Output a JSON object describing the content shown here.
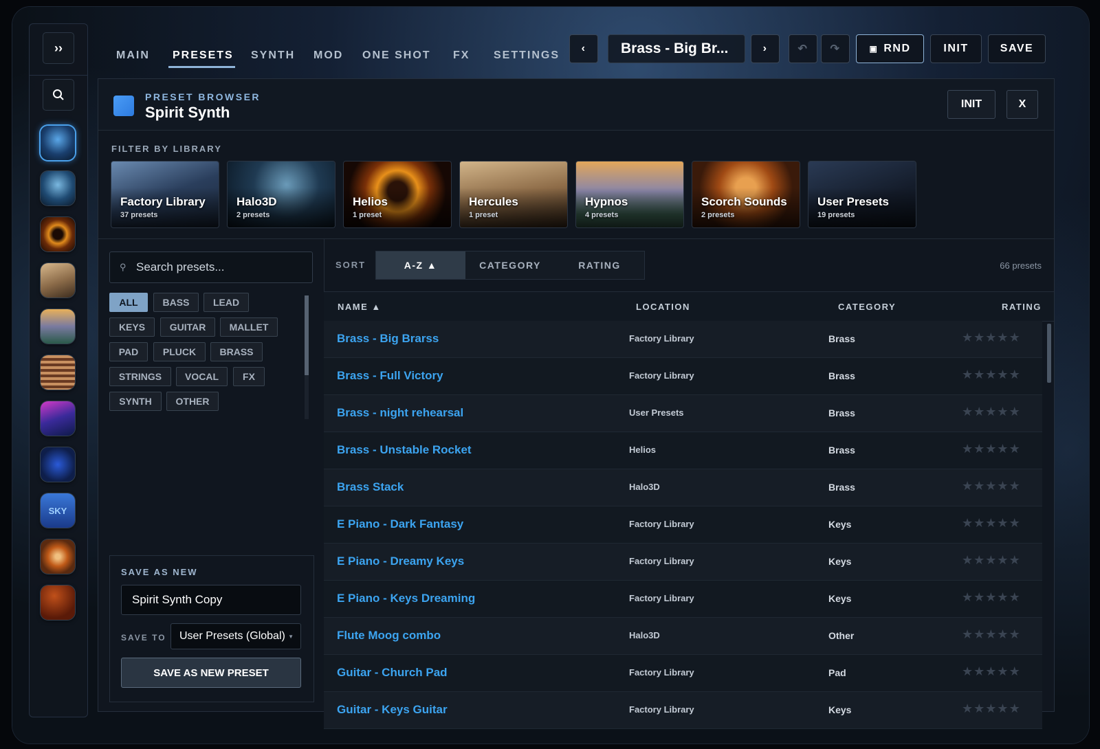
{
  "nav": {
    "tabs": [
      {
        "label": "MAIN"
      },
      {
        "label": "PRESETS"
      },
      {
        "label": "SYNTH"
      },
      {
        "label": "MOD"
      },
      {
        "label": "ONE SHOT"
      },
      {
        "label": "FX"
      },
      {
        "label": "SETTINGS"
      }
    ],
    "active_tab": "PRESETS",
    "current_preset": "Brass - Big Br...",
    "rnd_label": "RND",
    "init_label": "INIT",
    "save_label": "SAVE"
  },
  "sidebar": {
    "expand_icon": "double-chevron-right-icon",
    "search_icon": "search-icon",
    "library_thumbs": [
      "factory",
      "halo3d",
      "helios",
      "hercules",
      "hypnos",
      "scorch-strings",
      "synthwave",
      "user-presets",
      "sky-keys",
      "orbit",
      "ember"
    ]
  },
  "browser": {
    "section_label": "PRESET BROWSER",
    "title": "Spirit Synth",
    "init_label": "INIT",
    "close_label": "X",
    "filter_label": "FILTER BY LIBRARY",
    "libraries": [
      {
        "name": "Factory Library",
        "count": "37 presets"
      },
      {
        "name": "Halo3D",
        "count": "2 presets"
      },
      {
        "name": "Helios",
        "count": "1 preset"
      },
      {
        "name": "Hercules",
        "count": "1 preset"
      },
      {
        "name": "Hypnos",
        "count": "4 presets"
      },
      {
        "name": "Scorch Sounds",
        "count": "2 presets"
      },
      {
        "name": "User Presets",
        "count": "19 presets"
      }
    ]
  },
  "filters": {
    "search_placeholder": "Search presets...",
    "categories": [
      "ALL",
      "BASS",
      "LEAD",
      "KEYS",
      "GUITAR",
      "MALLET",
      "PAD",
      "PLUCK",
      "BRASS",
      "STRINGS",
      "VOCAL",
      "FX",
      "SYNTH",
      "OTHER"
    ],
    "active_category": "ALL"
  },
  "save_new": {
    "label": "SAVE AS NEW",
    "name_value": "Spirit Synth Copy",
    "save_to_label": "SAVE TO",
    "save_to_value": "User Presets (Global)",
    "button_label": "SAVE AS NEW PRESET"
  },
  "sort": {
    "label": "SORT",
    "options": [
      "A-Z ▲",
      "CATEGORY",
      "RATING"
    ],
    "active": "A-Z ▲",
    "count": "66 presets"
  },
  "table": {
    "columns": [
      "NAME ▲",
      "LOCATION",
      "CATEGORY",
      "RATING"
    ],
    "rows": [
      {
        "name": "Brass - Big Brarss",
        "location": "Factory Library",
        "category": "Brass",
        "rating": 0
      },
      {
        "name": "Brass - Full Victory",
        "location": "Factory Library",
        "category": "Brass",
        "rating": 0
      },
      {
        "name": "Brass - night rehearsal",
        "location": "User Presets",
        "category": "Brass",
        "rating": 0
      },
      {
        "name": "Brass - Unstable Rocket",
        "location": "Helios",
        "category": "Brass",
        "rating": 0
      },
      {
        "name": "Brass Stack",
        "location": "Halo3D",
        "category": "Brass",
        "rating": 0
      },
      {
        "name": "E Piano - Dark Fantasy",
        "location": "Factory Library",
        "category": "Keys",
        "rating": 0
      },
      {
        "name": "E Piano - Dreamy Keys",
        "location": "Factory Library",
        "category": "Keys",
        "rating": 0
      },
      {
        "name": "E Piano - Keys Dreaming",
        "location": "Factory Library",
        "category": "Keys",
        "rating": 0
      },
      {
        "name": "Flute Moog combo",
        "location": "Halo3D",
        "category": "Other",
        "rating": 0
      },
      {
        "name": "Guitar - Church Pad",
        "location": "Factory Library",
        "category": "Pad",
        "rating": 0
      },
      {
        "name": "Guitar - Keys Guitar",
        "location": "Factory Library",
        "category": "Keys",
        "rating": 0
      }
    ]
  },
  "colors": {
    "accent": "#3ca4f0",
    "active_chip": "#7fa3c6",
    "background": "#10161f"
  }
}
